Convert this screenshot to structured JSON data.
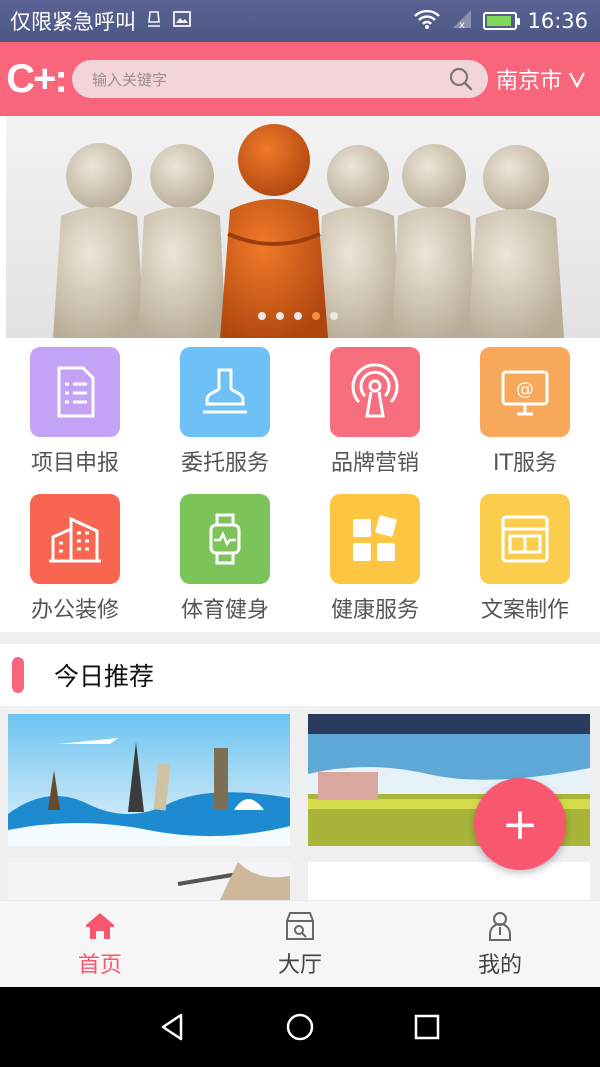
{
  "status": {
    "carrier": "仅限紧急呼叫",
    "time": "16:36",
    "battery_level": 0.8
  },
  "header": {
    "logo": "C+:",
    "search_placeholder": "输入关键字",
    "city": "南京市"
  },
  "banner": {
    "page_count": 5,
    "active_index": 3
  },
  "categories": [
    {
      "label": "项目申报",
      "icon": "document-icon",
      "color": "#c3a3f5"
    },
    {
      "label": "委托服务",
      "icon": "stamp-icon",
      "color": "#6ec1f6"
    },
    {
      "label": "品牌营销",
      "icon": "broadcast-icon",
      "color": "#f76f7f"
    },
    {
      "label": "IT服务",
      "icon": "monitor-icon",
      "color": "#f8a85a"
    },
    {
      "label": "办公装修",
      "icon": "building-icon",
      "color": "#f86550"
    },
    {
      "label": "体育健身",
      "icon": "smartwatch-icon",
      "color": "#7cc45a"
    },
    {
      "label": "健康服务",
      "icon": "blocks-icon",
      "color": "#fdc642"
    },
    {
      "label": "文案制作",
      "icon": "layout-icon",
      "color": "#fbcd4c"
    }
  ],
  "recommend": {
    "title": "今日推荐"
  },
  "fab": {
    "label": "+"
  },
  "tabs": [
    {
      "label": "首页",
      "icon": "home-icon",
      "active": true
    },
    {
      "label": "大厅",
      "icon": "store-icon",
      "active": false
    },
    {
      "label": "我的",
      "icon": "person-icon",
      "active": false
    }
  ],
  "colors": {
    "brand": "#f9657a",
    "accent": "#f9566f"
  }
}
